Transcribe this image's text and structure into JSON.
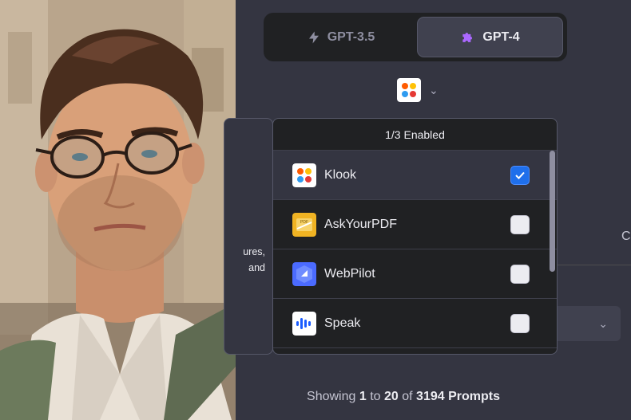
{
  "models": {
    "gpt35_label": "GPT-3.5",
    "gpt4_label": "GPT-4",
    "gpt35_icon": "lightning-icon",
    "gpt4_icon": "puzzle-icon",
    "selected": "GPT-4"
  },
  "plugin_picker": {
    "icon": "klook-logo",
    "chevron": "chevron-down-icon"
  },
  "dropdown": {
    "header": "1/3 Enabled",
    "items": [
      {
        "label": "Klook",
        "checked": true
      },
      {
        "label": "AskYourPDF",
        "checked": false
      },
      {
        "label": "WebPilot",
        "checked": false
      },
      {
        "label": "Speak",
        "checked": false
      }
    ]
  },
  "background_card": {
    "line1": "ures,",
    "line2": "and"
  },
  "right_panel": {
    "letter": "C"
  },
  "footer": {
    "prefix": "Showing",
    "from": "1",
    "to_word": "to",
    "to": "20",
    "of_word": "of",
    "total": "3194 Prompts"
  },
  "colors": {
    "background": "#343541",
    "panel": "#202123",
    "accent_check": "#1f6feb",
    "gpt4_icon": "#ab68ff"
  }
}
